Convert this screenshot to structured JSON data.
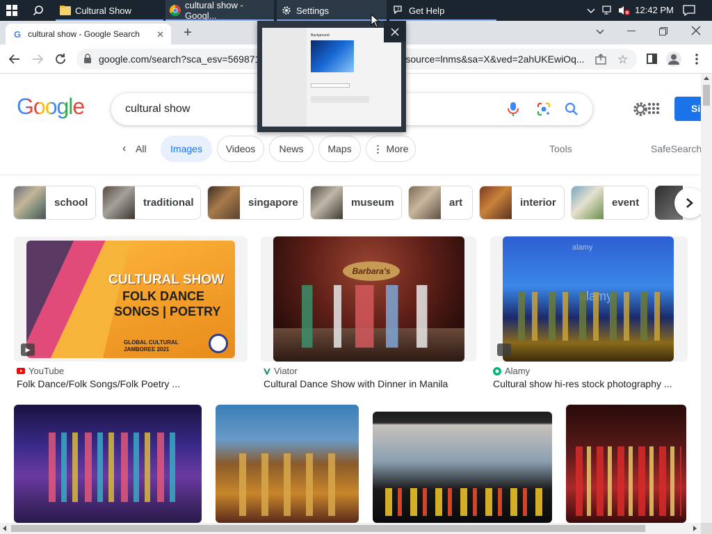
{
  "taskbar": {
    "apps": [
      {
        "label": "Cultural Show",
        "icon": "folder-icon"
      },
      {
        "label": "cultural show - Googl...",
        "icon": "chrome-icon"
      },
      {
        "label": "Settings",
        "icon": "gear-icon"
      },
      {
        "label": "Get Help",
        "icon": "help-icon"
      }
    ],
    "clock": "12:42 PM"
  },
  "browser": {
    "tab_title": "cultural show - Google Search",
    "url_left": "google.com/search?sca_esv=5698715",
    "url_right": "&source=lnms&sa=X&ved=2ahUKEwiOq..."
  },
  "google": {
    "logo": "Google",
    "query": "cultural show",
    "signin_label": "Si",
    "nav": {
      "all": "All",
      "images": "Images",
      "videos": "Videos",
      "news": "News",
      "maps": "Maps",
      "more": "More",
      "tools": "Tools",
      "safesearch": "SafeSearch"
    },
    "related": [
      "school",
      "traditional",
      "singapore",
      "museum",
      "art",
      "interior",
      "event"
    ],
    "results": [
      {
        "source": "YouTube",
        "caption": "Folk Dance/Folk Songs/Folk Poetry ...",
        "overlay": [
          "CULTURAL SHOW",
          "FOLK DANCE",
          "SONGS | POETRY",
          "GLOBAL CULTURAL JAMBOREE 2021"
        ]
      },
      {
        "source": "Viator",
        "caption": "Cultural Dance Show with Dinner in Manila",
        "overlay": [
          "Barbara's"
        ]
      },
      {
        "source": "Alamy",
        "caption": "Cultural show hi-res stock photography ...",
        "overlay": [
          "alamy",
          "alamy"
        ]
      }
    ]
  },
  "preview": {
    "heading": "Background"
  },
  "colors": {
    "taskbar": "#1b2530",
    "accent": "#1a73e8",
    "google_blue": "#4285f4",
    "google_red": "#ea4335",
    "google_yellow": "#fbbc05",
    "google_green": "#34a853"
  }
}
